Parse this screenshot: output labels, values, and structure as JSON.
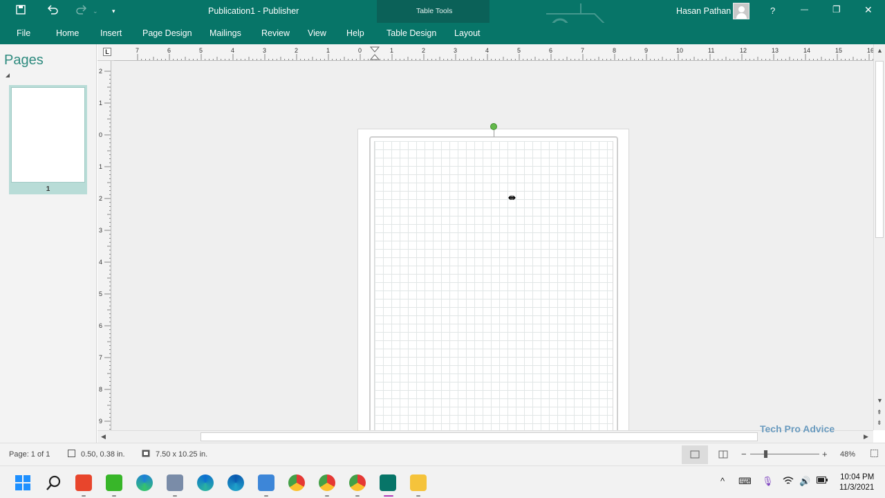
{
  "title_bar": {
    "document_title": "Publication1  -  Publisher",
    "context_group": "Table Tools",
    "user_name": "Hasan Pathan",
    "help": "?",
    "minimize": "—",
    "restore": "❐",
    "close": "✕"
  },
  "ribbon_tabs": [
    "File",
    "Home",
    "Insert",
    "Page Design",
    "Mailings",
    "Review",
    "View",
    "Help",
    "Table Design",
    "Layout"
  ],
  "pages_panel": {
    "title": "Pages",
    "thumbnails": [
      {
        "number": "1"
      }
    ]
  },
  "rulers": {
    "corner": "L",
    "horizontal_ticks": [
      "7",
      "6",
      "5",
      "4",
      "3",
      "2",
      "1",
      "0",
      "1",
      "2",
      "3",
      "4",
      "5",
      "6",
      "7",
      "8",
      "9",
      "10",
      "11",
      "12",
      "13",
      "14",
      "15",
      "16"
    ],
    "vertical_ticks": [
      "2",
      "1",
      "0",
      "1",
      "2",
      "3",
      "4",
      "5",
      "6",
      "7",
      "8",
      "9"
    ]
  },
  "watermark": "Tech Pro Advice",
  "status_bar": {
    "page": "Page: 1 of 1",
    "position": "0.50, 0.38 in.",
    "size": "7.50 x 10.25 in.",
    "zoom_minus": "−",
    "zoom_plus": "+",
    "zoom_level": "48%"
  },
  "taskbar": {
    "time": "10:04 PM",
    "date": "11/3/2021",
    "apps": [
      "windows-start",
      "search",
      "office-red",
      "excel-green",
      "edge",
      "printer",
      "edge-alt",
      "edge-beta",
      "notepad",
      "chrome",
      "chrome-profile",
      "chrome-profile-2",
      "publisher",
      "file-explorer"
    ]
  }
}
